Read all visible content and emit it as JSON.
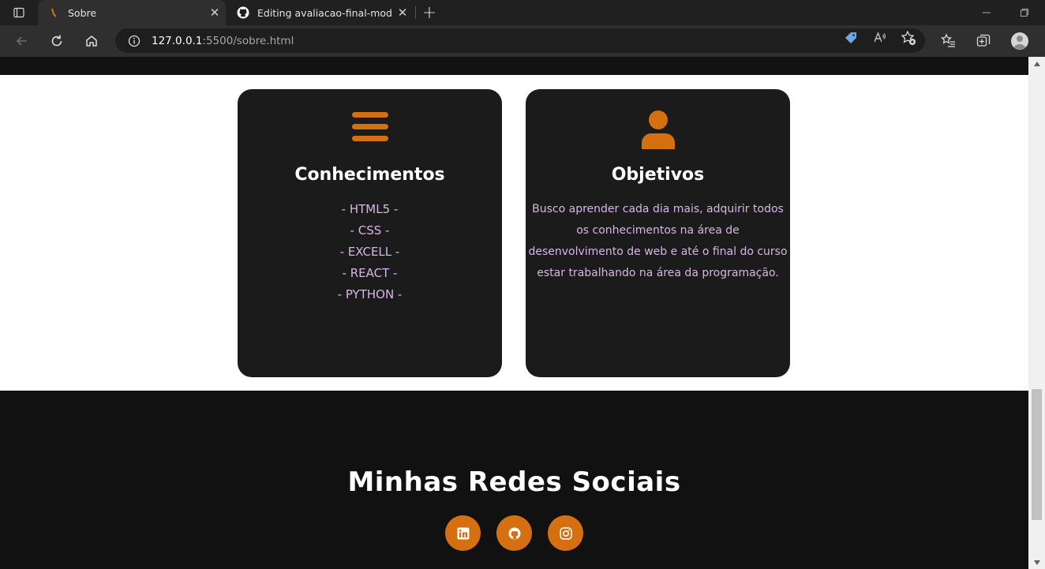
{
  "browser": {
    "tabs": [
      {
        "title": "Sobre",
        "active": true,
        "favicon": "html-favicon"
      },
      {
        "title": "Editing avaliacao-final-modulo-fi",
        "active": false,
        "favicon": "github-icon"
      }
    ],
    "new_tab_label": "+",
    "close_glyph": "✕",
    "address": {
      "host": "127.0.0.1",
      "rest": ":5500/sobre.html"
    }
  },
  "cards": {
    "conhecimentos": {
      "icon": "menu-bars-icon",
      "title": "Conhecimentos",
      "items": [
        "- HTML5 -",
        "- CSS -",
        "- EXCELL -",
        "- REACT -",
        "- PYTHON -"
      ]
    },
    "objetivos": {
      "icon": "user-icon",
      "title": "Objetivos",
      "text": "Busco aprender cada dia mais, adquirir todos os conhecimentos na área de desenvolvimento de web e até o final do curso estar trabalhando na área da programação."
    }
  },
  "footer": {
    "title": "Minhas Redes Sociais",
    "socials": [
      {
        "name": "linkedin",
        "icon": "linkedin-icon"
      },
      {
        "name": "github",
        "icon": "github-icon"
      },
      {
        "name": "instagram",
        "icon": "instagram-icon"
      }
    ]
  },
  "colors": {
    "accent": "#d4700f",
    "card_bg": "#1b1b1b",
    "card_text": "#d8b4e6",
    "footer_bg": "#111111"
  }
}
